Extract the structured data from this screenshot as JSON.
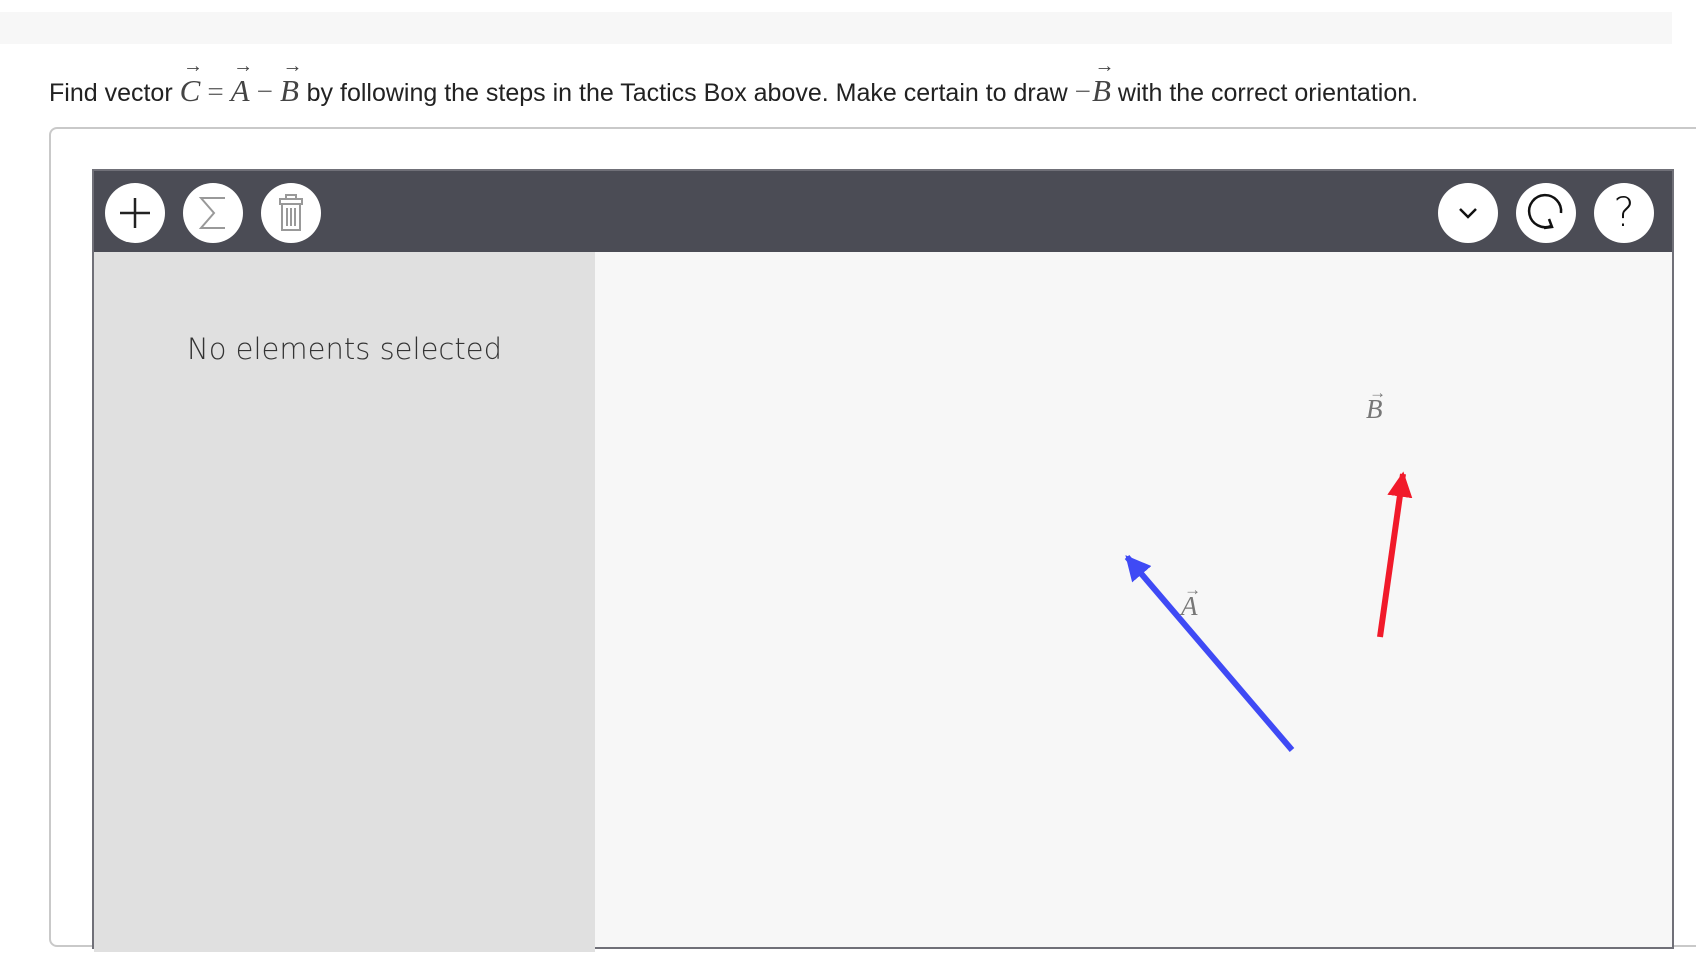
{
  "prompt": {
    "text_before": "Find vector",
    "vec_c": "C",
    "equals": "=",
    "vec_a": "A",
    "minus": "−",
    "vec_b": "B",
    "text_middle": "by following the steps in the Tactics Box above. Make certain to draw",
    "neg_sign": "−",
    "neg_b": "B",
    "text_after": "with the correct orientation.",
    "arrow_glyph": "→"
  },
  "toolbar": {
    "left_buttons": [
      "add-icon",
      "sum-icon",
      "trash-icon"
    ],
    "right_buttons": [
      "chevron-down-icon",
      "reset-icon",
      "help-icon"
    ],
    "help_glyph": "?",
    "background": "#4b4c55"
  },
  "sidebar": {
    "message": "No elements selected"
  },
  "canvas": {
    "vectors": [
      {
        "name": "A",
        "label": "A",
        "color": "#3f4af5"
      },
      {
        "name": "B",
        "label": "B",
        "color": "#f11a2a"
      }
    ]
  }
}
